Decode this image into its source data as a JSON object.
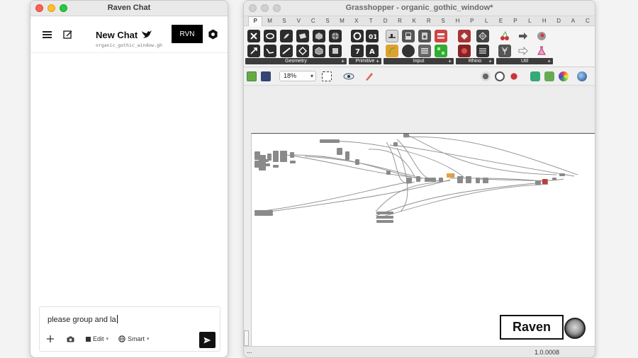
{
  "raven_window": {
    "title": "Raven Chat",
    "header": {
      "chat_title": "New Chat",
      "file_name": "organic_gothic_window.gh",
      "rvn_label": "RVN"
    },
    "input": {
      "text": "please group and la"
    },
    "toolbar": {
      "edit_label": "Edit",
      "mode_label": "Smart"
    },
    "icons": [
      "menu-icon",
      "compose-icon",
      "bird-icon",
      "settings-icon",
      "plus-icon",
      "camera-icon",
      "edit-icon",
      "globe-icon",
      "send-icon"
    ]
  },
  "gh_window": {
    "title": "Grasshopper - organic_gothic_window*",
    "tabs": [
      "P",
      "M",
      "S",
      "V",
      "C",
      "S",
      "M",
      "X",
      "T",
      "D",
      "R",
      "K",
      "R",
      "S",
      "H",
      "P",
      "L",
      "E",
      "P",
      "L",
      "H",
      "D",
      "A",
      "C"
    ],
    "active_tab": "P",
    "ribbon_groups": [
      "Geometry",
      "Primitive",
      "Input",
      "Rhino",
      "Util"
    ],
    "zoom": "18%",
    "raven_badge": "Raven",
    "version": "1.0.0008",
    "status_dots": "..."
  },
  "colors": {
    "accent_orange": "#e6a23c",
    "accent_red": "#c43a3a",
    "node_gray": "#8a8a8a",
    "black_button": "#000000"
  }
}
